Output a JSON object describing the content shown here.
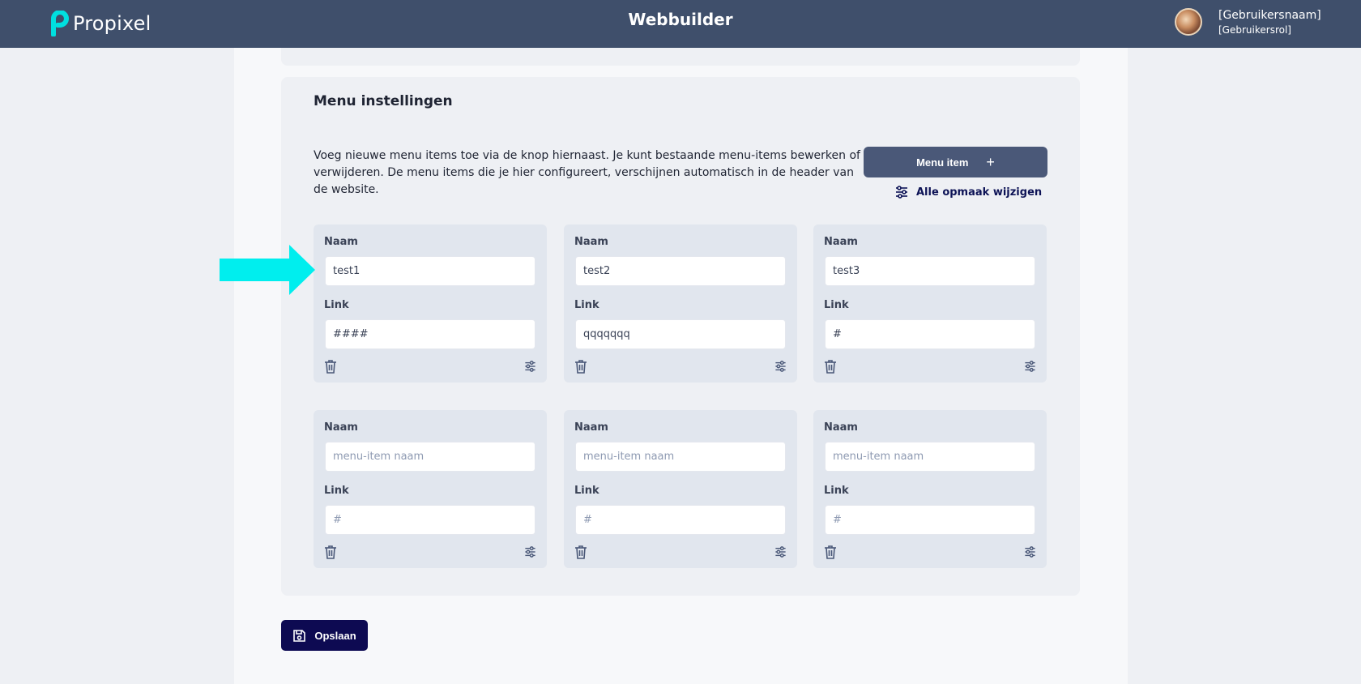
{
  "header": {
    "logo_text": "Propixel",
    "app_title": "Webbuilder",
    "user_name": "[Gebruikersnaam]",
    "user_role": "[Gebruikersrol]"
  },
  "menu_settings": {
    "title": "Menu instellingen",
    "description": "Voeg nieuwe menu items toe via de knop hiernaast. Je kunt bestaande menu-items bewerken of verwijderen. De menu items die je hier configureert, verschijnen automatisch in de header van de website.",
    "add_button_label": "Menu item",
    "add_button_icon": "+",
    "style_all_label": "Alle opmaak wijzigen"
  },
  "items": [
    {
      "name_label": "Naam",
      "name_value": "test1",
      "name_placeholder": "menu-item naam",
      "link_label": "Link",
      "link_value": "####",
      "link_placeholder": "#"
    },
    {
      "name_label": "Naam",
      "name_value": "test2",
      "name_placeholder": "menu-item naam",
      "link_label": "Link",
      "link_value": "qqqqqqq",
      "link_placeholder": "#"
    },
    {
      "name_label": "Naam",
      "name_value": "test3",
      "name_placeholder": "menu-item naam",
      "link_label": "Link",
      "link_value": "#",
      "link_placeholder": "#"
    },
    {
      "name_label": "Naam",
      "name_value": "",
      "name_placeholder": "menu-item naam",
      "link_label": "Link",
      "link_value": "",
      "link_placeholder": "#"
    },
    {
      "name_label": "Naam",
      "name_value": "",
      "name_placeholder": "menu-item naam",
      "link_label": "Link",
      "link_value": "",
      "link_placeholder": "#"
    },
    {
      "name_label": "Naam",
      "name_value": "",
      "name_placeholder": "menu-item naam",
      "link_label": "Link",
      "link_value": "",
      "link_placeholder": "#"
    }
  ],
  "footer": {
    "save_label": "Opslaan"
  },
  "colors": {
    "header_bg": "#3f4f6b",
    "accent_cyan": "#00e5e5",
    "add_button_bg": "#4a5878",
    "save_button_bg": "#0d0a52"
  }
}
